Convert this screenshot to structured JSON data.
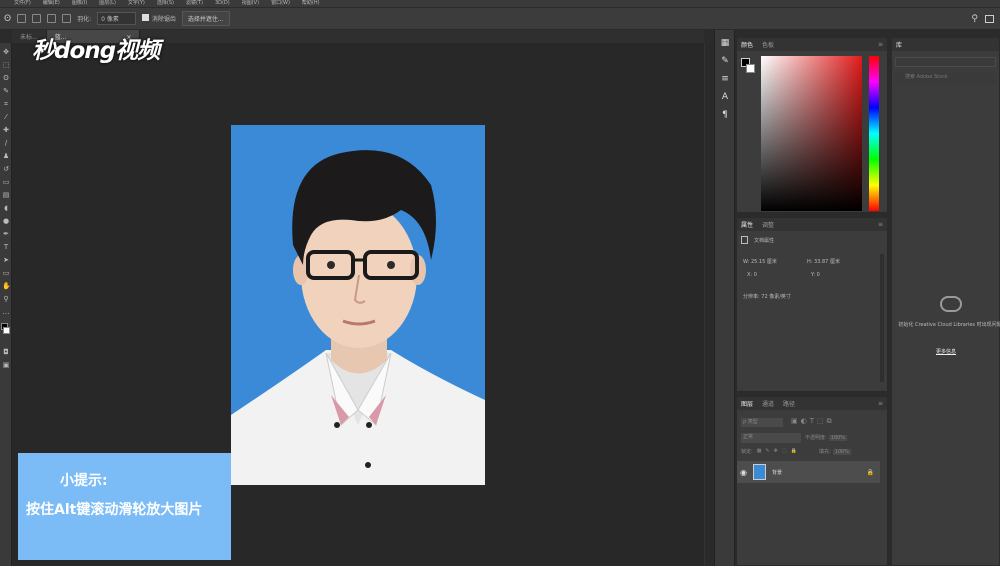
{
  "menubar": {
    "items": [
      "文件(F)",
      "编辑(E)",
      "图像(I)",
      "图层(L)",
      "文字(Y)",
      "选择(S)",
      "滤镜(T)",
      "3D(D)",
      "视图(V)",
      "窗口(W)",
      "帮助(H)"
    ]
  },
  "options": {
    "feather_label": "羽化:",
    "feather_value": "0 像素",
    "antialias_label": "消除锯齿",
    "select_mask_label": "选择并遮住..."
  },
  "tabs": [
    {
      "label": "未标..."
    },
    {
      "label": "蓝..."
    }
  ],
  "watermark": {
    "text": "秒dong视频"
  },
  "color_panel": {
    "tab_color": "颜色",
    "tab_swatches": "色板"
  },
  "library_panel": {
    "tab": "库",
    "search_placeholder": "搜索 Adobe Stock",
    "message": "初始化 Creative Cloud Libraries 时出现问题",
    "link": "更多信息"
  },
  "properties_panel": {
    "tab_props": "属性",
    "tab_adjust": "调整",
    "doc_props": "文档属性",
    "w_label": "W:",
    "w_value": "25.15 厘米",
    "h_label": "H:",
    "h_value": "33.87 厘米",
    "x_label": "X:",
    "x_value": "0",
    "y_label": "Y:",
    "y_value": "0",
    "resolution": "分辨率: 72 像素/英寸"
  },
  "layers_panel": {
    "tab_layers": "图层",
    "tab_channels": "通道",
    "tab_paths": "路径",
    "kind": "ρ 类型",
    "blend_mode": "正常",
    "opacity_label": "不透明度:",
    "opacity_value": "100%",
    "lock_label": "锁定:",
    "fill_label": "填充:",
    "fill_value": "100%",
    "layer_name": "背景"
  },
  "hint": {
    "title": "小提示:",
    "text": "按住Alt键滚动滑轮放大图片"
  },
  "colors": {
    "accent": "#3a8ad8",
    "hint_bg": "#7cbcf6"
  }
}
